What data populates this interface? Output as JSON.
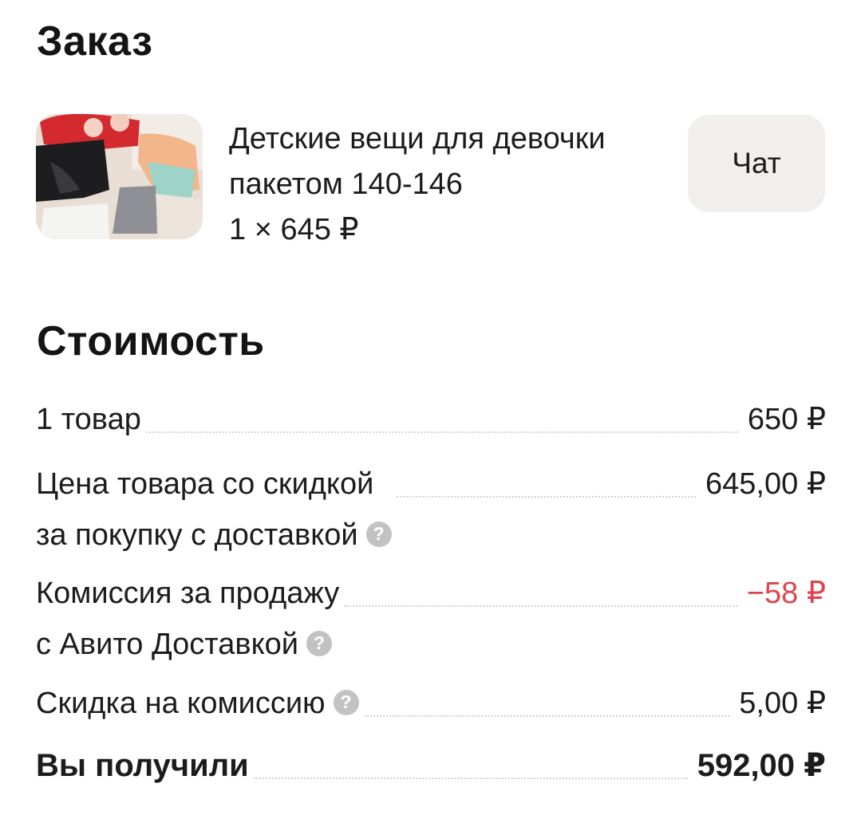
{
  "order": {
    "title": "Заказ",
    "product": {
      "name_line1": "Детские вещи для девочки",
      "name_line2": "пакетом 140-146",
      "quantity_price": "1 × 645 ₽"
    },
    "chat_label": "Чат"
  },
  "cost": {
    "title": "Стоимость",
    "rows": [
      {
        "label": "1 товар",
        "value": "650 ₽"
      },
      {
        "label_line1": "Цена товара со скидкой",
        "label_line2": "за покупку с доставкой",
        "value": "645,00 ₽",
        "help": "?"
      },
      {
        "label_line1": "Комиссия за продажу",
        "label_line2": "с Авито Доставкой",
        "value": "−58 ₽",
        "value_color": "#e0434e",
        "help": "?"
      },
      {
        "label": "Скидка на комиссию",
        "value": "5,00 ₽",
        "help": "?"
      }
    ],
    "total": {
      "label": "Вы получили",
      "value": "592,00 ₽"
    }
  },
  "icons": {
    "help": "question-circle-icon"
  },
  "colors": {
    "text": "#1c1c1c",
    "negative": "#e0434e",
    "button_bg": "#f0efee",
    "help_icon_bg": "#c2c2c2"
  }
}
